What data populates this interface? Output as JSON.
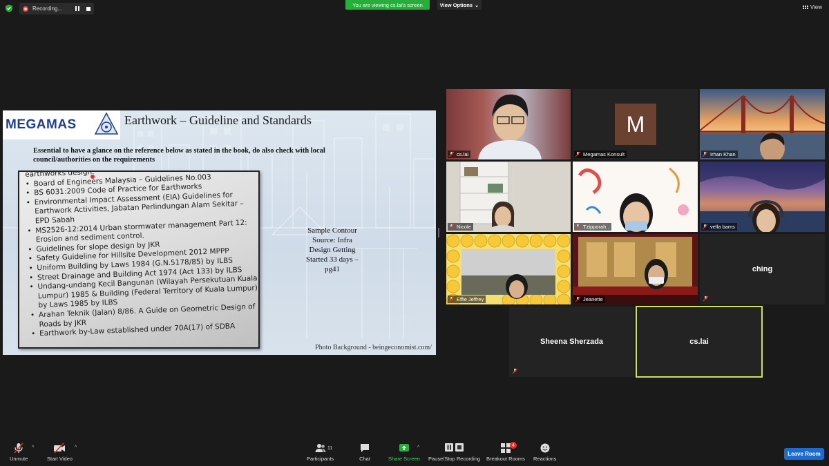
{
  "topbar": {
    "recording_label": "Recording...",
    "viewing_banner": "You are viewing cs.lai's screen",
    "view_options_label": "View Options",
    "view_label": "View"
  },
  "slide": {
    "logo_text": "MEGAMAS",
    "title": "Earthwork – Guideline and Standards",
    "intro": "Essential to have a glance on the reference below as stated in the book, do also check with local council/authorities on the requirements",
    "photo_heading": "earthworks design.",
    "items": [
      "Board of Engineers Malaysia – Guidelines No.003",
      "BS 6031:2009 Code of Practice for Earthworks",
      "Environmental Impact Assessment (EIA) Guidelines for Earthwork Activities, Jabatan Perlindungan Alam Sekitar – EPD Sabah",
      "MS2526-12:2014 Urban stormwater management Part 12: Erosion and sediment control.",
      "Guidelines for slope design by JKR",
      "Safety Guideline for Hillsite Development 2012 MPPP",
      "Uniform Building by Laws 1984 (G.N.5178/85) by ILBS",
      "Street Drainage and Building Act 1974 (Act 133) by ILBS",
      "Undang-undang Kecil Bangunan (Wilayah Persekutuan Kuala Lumpur) 1985 & Building (Federal Territory of Kuala Lumpur) by Laws 1985 by ILBS",
      "Arahan Teknik (Jalan) 8/86. A Guide on Geometric Design of Roads by JKR",
      "Earthwork by-Law established under 70A(17) of SDBA"
    ],
    "sample_lines": [
      "Sample Contour",
      "Source: Infra",
      "Design Getting",
      "Started 33 days –",
      "pg41"
    ],
    "photo_credit": "Photo Background - beingeconomist.com/"
  },
  "participants": {
    "tiles": [
      {
        "name": "cs.lai",
        "kind": "video"
      },
      {
        "name": "Megamas Konsult",
        "kind": "avatar",
        "initial": "M"
      },
      {
        "name": "Irhan Khan",
        "kind": "video"
      },
      {
        "name": "Nicole",
        "kind": "video"
      },
      {
        "name": "Tzipporah .",
        "kind": "video"
      },
      {
        "name": "vella bams",
        "kind": "video"
      },
      {
        "name": "Effie Jeffrey",
        "kind": "video"
      },
      {
        "name": "Jeanette",
        "kind": "video"
      },
      {
        "name": "ching",
        "kind": "name"
      },
      {
        "name": "Sheena Sherzada",
        "kind": "name"
      },
      {
        "name": "cs.lai",
        "kind": "name",
        "active": true
      }
    ]
  },
  "toolbar": {
    "unmute": "Unmute",
    "start_video": "Start Video",
    "participants": "Participants",
    "participants_count": "11",
    "chat": "Chat",
    "share_screen": "Share Screen",
    "pause_stop_recording": "Pause/Stop Recording",
    "breakout_rooms": "Breakout Rooms",
    "breakout_count": "4",
    "reactions": "Reactions",
    "leave_room": "Leave Room"
  },
  "colors": {
    "active_speaker_border": "#c8e063",
    "share_green": "#27ae3a",
    "leave_blue": "#1c6bd1",
    "mic_muted_red": "#e0302a"
  }
}
